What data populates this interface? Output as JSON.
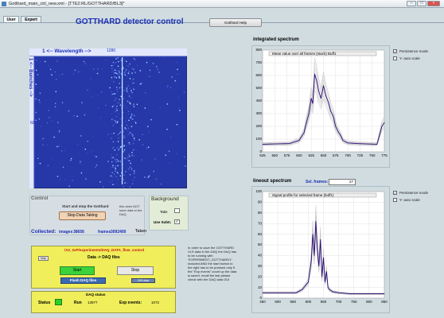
{
  "window": {
    "title": "Gotthard_main_ctrl_new.xml - [TTE2:RL/GOTTHARD/BL3]*"
  },
  "tabs": [
    {
      "label": "User"
    },
    {
      "label": "Expert"
    }
  ],
  "app": {
    "title": "GOTTHARD detector control",
    "help_label": "Gotthard Help"
  },
  "image": {
    "wavelength_label": "1 <-- Wavelength -->",
    "wavelength_max": "1280",
    "strips_label": "1 <-- Bunches -->",
    "strips_max": "60"
  },
  "control": {
    "title": "Control",
    "start_stop_label": "Start and stop the Gotthard",
    "stop_label": "Stop Data Taking",
    "note": "this does NOT save data to the DAQ",
    "collected_label": "Collected:",
    "images_label": "images",
    "images_value": "38656",
    "frames_label": "frames",
    "frames_value": "3092400",
    "taken_label": "Taken"
  },
  "background": {
    "title": "Background",
    "take_label": "Take",
    "subtract_label": "Use Subtr.",
    "subtract_checked": "✓"
  },
  "daq": {
    "path": "/A2_2xP/experiments/DAQ_DATA_flow_control",
    "help_label": "help",
    "files_label": "Data -> DAQ files",
    "start_label": "Start",
    "stop_label": "Stop",
    "flush_label": "Flush DAQ files",
    "dir_label": "DIR data",
    "status_title": "DAQ status",
    "status_label": "Status",
    "run_label": "Run",
    "run_value": "13977",
    "events_label": "Exp events:",
    "events_value": "1072",
    "instructions": "In order to save the GOTTHARD VLS data in the DAQ the DAQ has to be running with \"EXPERIMENT_GOTTHARD1\" included AND the start button to the right has to be pressed only if the \"Exp events\" count up the data is saved. recall the last please check with the DAQ data GUI"
  },
  "integrated": {
    "title": "integrated spectrum",
    "legend": "Mean value over all frames (stack) Buff1",
    "persistence_label": "Persistence mode",
    "persistence_checked": "✓",
    "autoscale_label": "Y- auto scale"
  },
  "lineout": {
    "title": "lineout spectrum",
    "sel_frames_label": "Sel. frames:",
    "sel_frames_value": "27",
    "legend": "Signal profile for selected frame (buff1)",
    "persistence_label": "Persistence mode",
    "persistence_checked": "✓",
    "autoscale_label": "Y- auto scale"
  },
  "colors": {
    "accent": "#1a2fb3",
    "image_bg": "#3044b8",
    "daq_panel": "#f0ee5a",
    "start_green": "#3bd23b"
  },
  "chart_data": [
    {
      "type": "line",
      "title": "integrated spectrum",
      "xlabel": "",
      "ylabel": "",
      "xlim": [
        525,
        775
      ],
      "ylim": [
        0,
        800
      ],
      "xticks": [
        525,
        550,
        575,
        600,
        625,
        650,
        675,
        700,
        725,
        750,
        775
      ],
      "yticks": [
        0,
        100,
        200,
        300,
        400,
        500,
        600,
        700,
        800
      ],
      "series": [
        {
          "name": "Mean value over all frames (stack) Buff1",
          "x": [
            525,
            580,
            600,
            610,
            615,
            620,
            625,
            628,
            632,
            636,
            640,
            645,
            650,
            655,
            660,
            665,
            670,
            675,
            680,
            685,
            690,
            700,
            720,
            740,
            760,
            770,
            775
          ],
          "y": [
            60,
            65,
            90,
            150,
            230,
            300,
            420,
            380,
            610,
            560,
            480,
            420,
            520,
            440,
            390,
            320,
            280,
            200,
            160,
            130,
            90,
            70,
            65,
            62,
            60,
            200,
            230
          ]
        }
      ]
    },
    {
      "type": "line",
      "title": "lineout spectrum",
      "xlabel": "",
      "ylabel": "",
      "xlim": [
        450,
        850
      ],
      "ylim": [
        0,
        100
      ],
      "xticks": [
        450,
        500,
        550,
        600,
        650,
        700,
        750,
        800,
        850
      ],
      "yticks": [
        0,
        10,
        20,
        30,
        40,
        50,
        60,
        70,
        80,
        90,
        100
      ],
      "series": [
        {
          "name": "Signal profile for selected frame (buff1)",
          "x": [
            450,
            560,
            580,
            600,
            610,
            615,
            620,
            625,
            630,
            635,
            640,
            645,
            650,
            655,
            660,
            665,
            670,
            680,
            700,
            740,
            800,
            850
          ],
          "y": [
            5,
            5,
            8,
            15,
            35,
            60,
            40,
            72,
            45,
            30,
            55,
            20,
            38,
            15,
            25,
            10,
            8,
            6,
            5,
            4,
            4,
            4
          ]
        }
      ]
    }
  ]
}
